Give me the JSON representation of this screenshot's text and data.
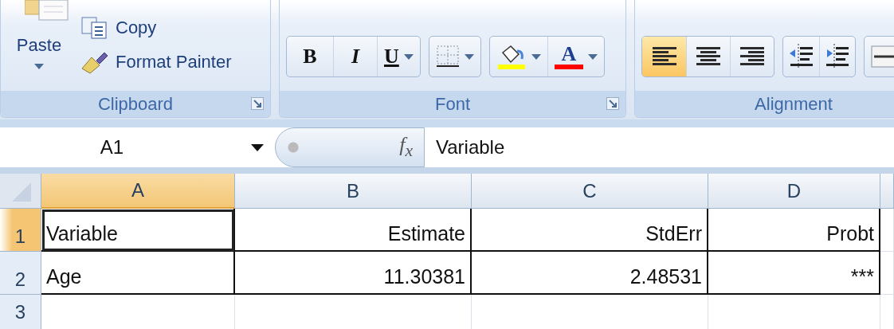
{
  "ribbon": {
    "groups": [
      {
        "kind": "clipboard",
        "label": "Clipboard",
        "launcher": true,
        "paste": {
          "label": "Paste",
          "dropdown": true
        },
        "items": [
          {
            "kind": "copy",
            "label": "Copy"
          },
          {
            "kind": "painter",
            "label": "Format Painter"
          }
        ]
      },
      {
        "kind": "font",
        "label": "Font",
        "launcher": true,
        "button_groups": [
          [
            {
              "kind": "bold",
              "label": "B",
              "selected": false
            },
            {
              "kind": "italic",
              "label": "I",
              "selected": false
            },
            {
              "kind": "underline",
              "label": "U",
              "selected": false,
              "dropdown": true
            }
          ],
          [
            {
              "kind": "borders",
              "selected": false,
              "dropdown": true
            }
          ],
          [
            {
              "kind": "fill",
              "selected": false,
              "dropdown": true,
              "color": "#ffff00"
            },
            {
              "kind": "font_color",
              "label": "A",
              "selected": false,
              "dropdown": true,
              "color": "#ff0000"
            }
          ]
        ]
      },
      {
        "kind": "alignment",
        "label": "Alignment",
        "button_groups": [
          [
            {
              "kind": "align_left",
              "selected": true
            },
            {
              "kind": "align_center",
              "selected": false
            },
            {
              "kind": "align_right",
              "selected": false
            }
          ],
          [
            {
              "kind": "indent_decrease",
              "selected": false
            },
            {
              "kind": "indent_increase",
              "selected": false
            }
          ],
          [
            {
              "kind": "wrap",
              "selected": false
            }
          ]
        ]
      }
    ]
  },
  "formula_bar": {
    "name_box": "A1",
    "fx": "f$_{x}$",
    "value": "Variable"
  },
  "sheet": {
    "columns": [
      {
        "label": "A",
        "selected": true,
        "kind": "label"
      },
      {
        "label": "B",
        "selected": false,
        "kind": "value"
      },
      {
        "label": "C",
        "selected": false,
        "kind": "value"
      },
      {
        "label": "D",
        "selected": false,
        "kind": "value"
      }
    ],
    "rows": [
      {
        "header": "1",
        "selected": true,
        "cells": [
          "Variable",
          "Estimate",
          "StdErr",
          "Probt"
        ]
      },
      {
        "header": "2",
        "selected": false,
        "cells": [
          "Age",
          "11.30381",
          "2.48531",
          "***"
        ]
      },
      {
        "header": "3",
        "selected": false
      }
    ]
  }
}
